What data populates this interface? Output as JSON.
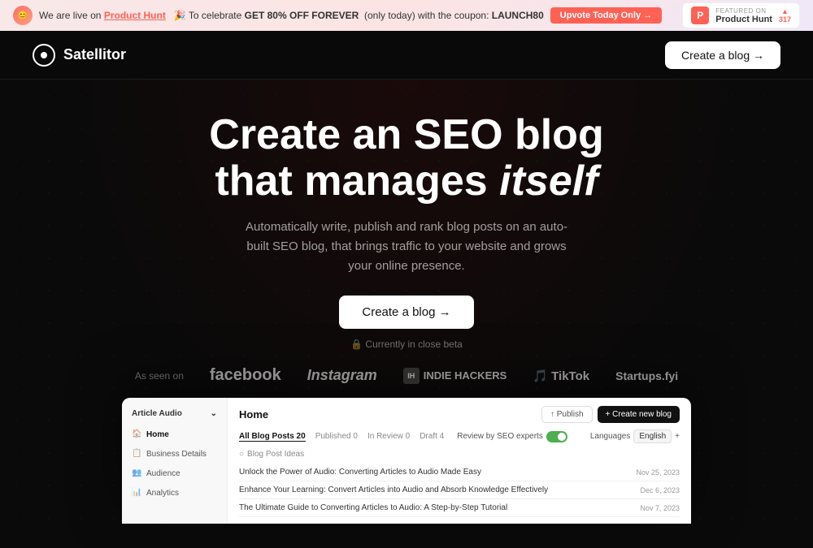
{
  "banner": {
    "avatar_text": "😊",
    "live_text": "We are live on",
    "product_hunt_label": "Product Hunt",
    "celebrate_text": "🎉 To celebrate",
    "deal_text": "GET 80% OFF FOREVER",
    "deal_note": "(only today) with the coupon:",
    "coupon_code": "LAUNCH80",
    "upvote_label": "Upvote Today Only →",
    "ph_featured": "FEATURED ON",
    "ph_name": "Product Hunt",
    "ph_votes": "▲",
    "ph_count": "317"
  },
  "navbar": {
    "logo_text": "Satellitor",
    "cta_label": "Create a blog →"
  },
  "hero": {
    "title_line1": "Create an SEO blog",
    "title_line2": "that manages",
    "title_italic": "itself",
    "subtitle": "Automatically write, publish and rank blog posts on an auto-built SEO blog, that brings traffic to your website and grows your online presence.",
    "cta_label": "Create a blog →",
    "beta_note": "🔒 Currently in close beta"
  },
  "as_seen": {
    "label": "As seen on",
    "brands": [
      "facebook",
      "Instagram",
      "INDIE HACKERS",
      "TikTok",
      "Startups.fyi"
    ]
  },
  "dashboard": {
    "sidebar": {
      "brand": "Article Audio",
      "items": [
        {
          "label": "Home",
          "icon": "🏠",
          "active": true
        },
        {
          "label": "Business Details",
          "icon": "📋",
          "active": false
        },
        {
          "label": "Audience",
          "icon": "👥",
          "active": false
        },
        {
          "label": "Analytics",
          "icon": "📊",
          "active": false
        }
      ]
    },
    "main": {
      "title": "Home",
      "btn_publish": "↑ Publish",
      "btn_create": "+ Create new blog",
      "tabs": [
        {
          "label": "All Blog Posts 20",
          "active": true
        },
        {
          "label": "Published 0",
          "active": false
        },
        {
          "label": "In Review 0",
          "active": false
        },
        {
          "label": "Draft 4",
          "active": false
        },
        {
          "label": "Review by SEO experts",
          "active": false
        }
      ],
      "lang_label": "Languages",
      "lang_value": "English",
      "section_label": "Blog Post Ideas",
      "posts": [
        {
          "title": "Unlock the Power of Audio: Converting Articles to Audio Made Easy",
          "date": "Nov 25, 2023"
        },
        {
          "title": "Enhance Your Learning: Convert Articles into Audio and Absorb Knowledge Effectively",
          "date": "Dec 6, 2023"
        },
        {
          "title": "The Ultimate Guide to Converting Articles to Audio: A Step-by-Step Tutorial",
          "date": "Nov 7, 2023"
        }
      ]
    }
  }
}
